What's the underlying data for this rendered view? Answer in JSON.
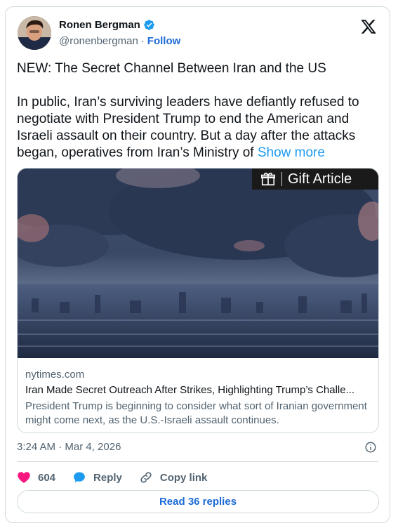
{
  "author": {
    "name": "Ronen Bergman",
    "handle": "@ronenbergman",
    "separator": "·",
    "follow_label": "Follow"
  },
  "tweet": {
    "headline": "NEW: The Secret Channel Between Iran and the US",
    "body": "In public, Iran’s surviving leaders have defiantly refused to negotiate with President Trump to end the American and Israeli assault on their country. But a day after the attacks began, operatives from Iran’s Ministry of ",
    "show_more_label": "Show more"
  },
  "link_card": {
    "gift_label": "Gift Article",
    "domain": "nytimes.com",
    "title": "Iran Made Secret Outreach After Strikes, Highlighting Trump’s Challe...",
    "description": "President Trump is beginning to consider what sort of Iranian government might come next, as the U.S.-Israeli assault continues."
  },
  "meta": {
    "timestamp": "3:24 AM · Mar 4, 2026"
  },
  "actions": {
    "likes_count": "604",
    "reply_label": "Reply",
    "copy_link_label": "Copy link"
  },
  "read_replies_label": "Read 36 replies",
  "icons": [
    "verified-badge-icon",
    "x-logo-icon",
    "gift-icon",
    "info-icon",
    "heart-icon",
    "reply-icon",
    "link-icon"
  ],
  "colors": {
    "link_blue": "#1d9bf0",
    "follow_blue": "#1d6bd6",
    "heart_red": "#f91880",
    "muted_text": "#536471",
    "border": "#cfd9de"
  }
}
